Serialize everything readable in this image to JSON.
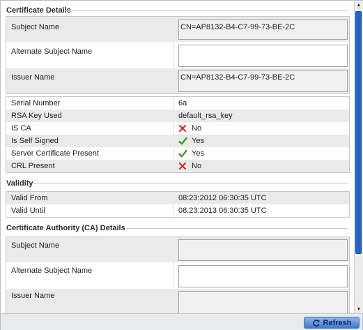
{
  "sections": {
    "certificate_details": "Certificate Details",
    "validity": "Validity",
    "ca_details": "Certificate Authority (CA) Details"
  },
  "certificate": {
    "subject_name_label": "Subject Name",
    "subject_name_value": "CN=AP8132-B4-C7-99-73-BE-2C",
    "alternate_subject_name_label": "Alternate Subject Name",
    "alternate_subject_name_value": "",
    "issuer_name_label": "Issuer Name",
    "issuer_name_value": "CN=AP8132-B4-C7-99-73-BE-2C"
  },
  "properties": [
    {
      "label": "Serial Number",
      "value": "6a",
      "icon": ""
    },
    {
      "label": "RSA Key Used",
      "value": "default_rsa_key",
      "icon": ""
    },
    {
      "label": "IS CA",
      "value": "No",
      "icon": "cross-icon"
    },
    {
      "label": "Is Self Signed",
      "value": "Yes",
      "icon": "check-icon"
    },
    {
      "label": "Server Certificate Present",
      "value": "Yes",
      "icon": "check-icon"
    },
    {
      "label": "CRL Present",
      "value": "No",
      "icon": "cross-icon"
    }
  ],
  "validity": {
    "valid_from_label": "Valid From",
    "valid_from_value": "08:23:2012 06:30:35 UTC",
    "valid_until_label": "Valid Until",
    "valid_until_value": "08:23:2013 06:30:35 UTC"
  },
  "ca": {
    "subject_name_label": "Subject Name",
    "subject_name_value": "",
    "alternate_subject_name_label": "Alternate Subject Name",
    "alternate_subject_name_value": "",
    "issuer_name_label": "Issuer Name",
    "issuer_name_value": ""
  },
  "footer": {
    "refresh_label": "Refresh",
    "refresh_icon": "refresh-icon"
  },
  "colors": {
    "check": "#3a9a2a",
    "cross": "#d42a2a",
    "scroll_thumb": "#1d66c8",
    "button": "#3f78cc"
  }
}
